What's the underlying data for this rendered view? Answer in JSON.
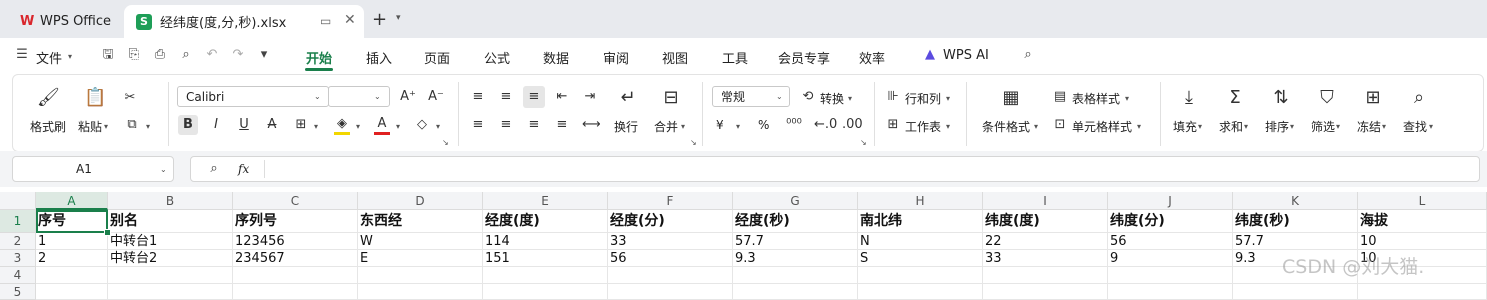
{
  "tabs": {
    "home_label": "WPS Office",
    "file_label": "经纬度(度,分,秒).xlsx",
    "file_icon_letter": "S"
  },
  "menu": {
    "file_label": "文件",
    "items": [
      "开始",
      "插入",
      "页面",
      "公式",
      "数据",
      "审阅",
      "视图",
      "工具",
      "会员专享",
      "效率"
    ],
    "ai_label": "WPS AI",
    "active": "开始"
  },
  "ribbon": {
    "format_painter": "格式刷",
    "paste": "粘贴",
    "font_name": "Calibri",
    "font_size": "",
    "wrap": "换行",
    "merge": "合并",
    "number_format": "常规",
    "convert": "转换",
    "row_col": "行和列",
    "worksheet": "工作表",
    "cond_format": "条件格式",
    "table_style": "表格样式",
    "cell_style": "单元格样式",
    "fill": "填充",
    "sum": "求和",
    "sort": "排序",
    "filter": "筛选",
    "freeze": "冻结",
    "find": "查找",
    "currency": "¥",
    "percent": "%"
  },
  "formula_bar": {
    "name_box": "A1",
    "fx": "fx",
    "formula": ""
  },
  "sheet": {
    "columns": [
      "A",
      "B",
      "C",
      "D",
      "E",
      "F",
      "G",
      "H",
      "I",
      "J",
      "K",
      "L"
    ],
    "selected_column": "A",
    "selected_row": "1",
    "row_numbers": [
      "1",
      "2",
      "3",
      "4",
      "5"
    ],
    "rows": [
      [
        "序号",
        "别名",
        "序列号",
        "东西经",
        "经度(度)",
        "经度(分)",
        "经度(秒)",
        "南北纬",
        "纬度(度)",
        "纬度(分)",
        "纬度(秒)",
        "海拔"
      ],
      [
        "1",
        "中转台1",
        "123456",
        "W",
        "114",
        "33",
        "57.7",
        "N",
        "22",
        "56",
        "57.7",
        "10"
      ],
      [
        "2",
        "中转台2",
        "234567",
        "E",
        "151",
        "56",
        "9.3",
        "S",
        "33",
        "9",
        "9.3",
        "10"
      ],
      [
        "",
        "",
        "",
        "",
        "",
        "",
        "",
        "",
        "",
        "",
        "",
        ""
      ],
      [
        "",
        "",
        "",
        "",
        "",
        "",
        "",
        "",
        "",
        "",
        "",
        ""
      ]
    ]
  },
  "watermark": "CSDN @刘大猫."
}
